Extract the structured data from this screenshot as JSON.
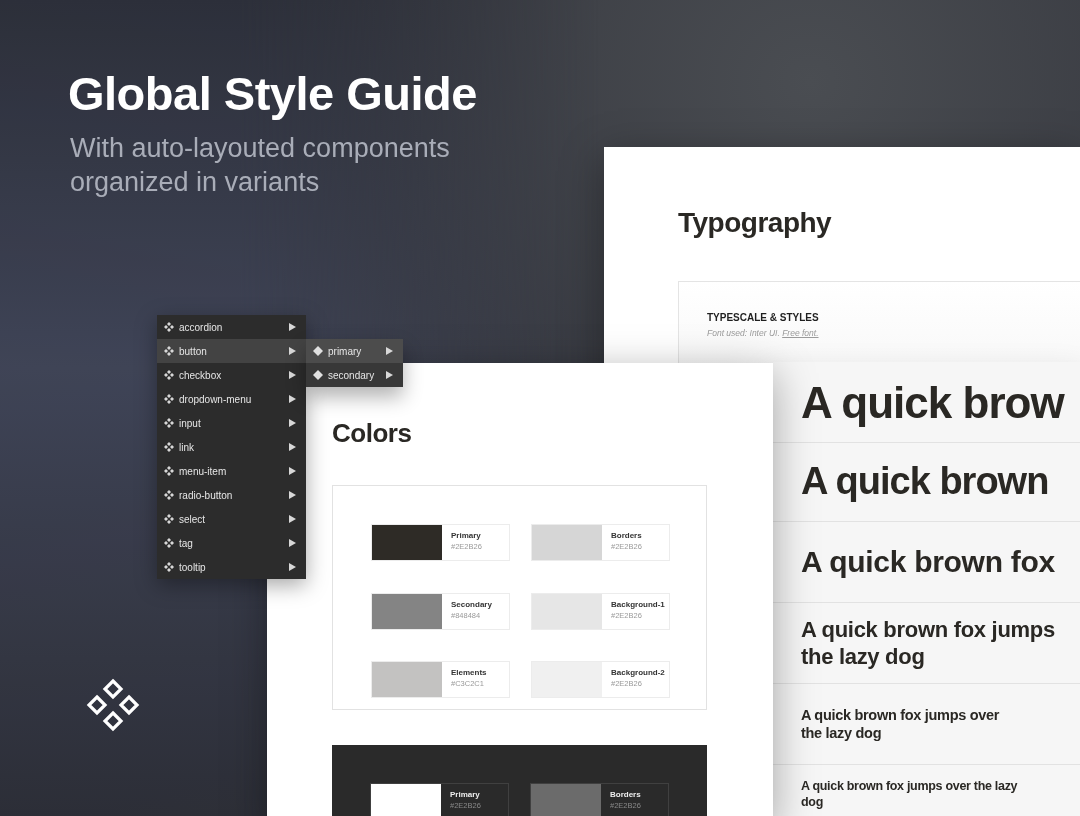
{
  "header": {
    "title": "Global Style Guide",
    "subtitle": "With auto-layouted components organized in variants"
  },
  "component_menu": {
    "items": [
      {
        "label": "accordion",
        "selected": false
      },
      {
        "label": "button",
        "selected": true
      },
      {
        "label": "checkbox",
        "selected": false
      },
      {
        "label": "dropdown-menu",
        "selected": false
      },
      {
        "label": "input",
        "selected": false
      },
      {
        "label": "link",
        "selected": false
      },
      {
        "label": "menu-item",
        "selected": false
      },
      {
        "label": "radio-button",
        "selected": false
      },
      {
        "label": "select",
        "selected": false
      },
      {
        "label": "tag",
        "selected": false
      },
      {
        "label": "tooltip",
        "selected": false
      }
    ],
    "submenu": {
      "items": [
        {
          "label": "primary",
          "selected": true
        },
        {
          "label": "secondary",
          "selected": false
        }
      ]
    }
  },
  "typography_page": {
    "title": "Typography",
    "section": {
      "heading": "TYPESCALE & STYLES",
      "note": "Font used: Inter UI.",
      "link": "Free font."
    }
  },
  "type_specimens": [
    {
      "kind": "h1",
      "lines": [
        "A quick brow"
      ]
    },
    {
      "kind": "h2",
      "lines": [
        "A quick brown"
      ]
    },
    {
      "kind": "h3",
      "lines": [
        "A quick brown fox"
      ]
    },
    {
      "kind": "h4",
      "lines": [
        "A quick brown fox jumps",
        "the lazy dog"
      ]
    },
    {
      "kind": "h5",
      "lines": [
        "A quick brown fox jumps over",
        "the lazy dog"
      ]
    },
    {
      "kind": "h6",
      "lines": [
        "A quick brown fox jumps over the lazy",
        "dog"
      ]
    }
  ],
  "colors_page": {
    "title": "Colors",
    "light_palette": [
      {
        "name": "Primary",
        "hex": "#2E2B26",
        "color": "#2e2b26"
      },
      {
        "name": "Borders",
        "hex": "#2E2B26",
        "color": "#d6d6d6"
      },
      {
        "name": "Secondary",
        "hex": "#848484",
        "color": "#848484"
      },
      {
        "name": "Background-1",
        "hex": "#2E2B26",
        "color": "#e6e6e6"
      },
      {
        "name": "Elements",
        "hex": "#C3C2C1",
        "color": "#c3c2c1"
      },
      {
        "name": "Background-2",
        "hex": "#2E2B26",
        "color": "#f0f0f0"
      }
    ],
    "dark_palette": [
      {
        "name": "Primary",
        "hex": "#2E2B26",
        "color": "#ffffff"
      },
      {
        "name": "Borders",
        "hex": "#2E2B26",
        "color": "#6b6b6b"
      }
    ]
  }
}
